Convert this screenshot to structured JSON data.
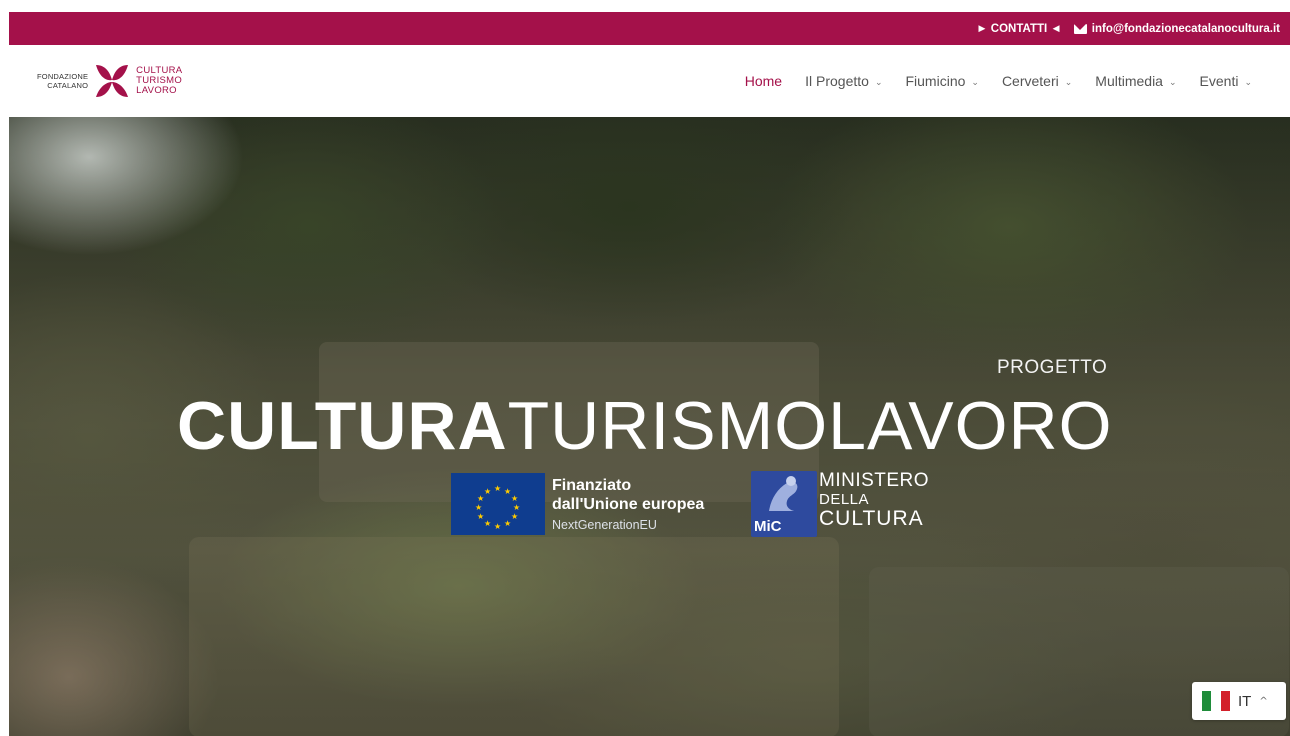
{
  "topbar": {
    "contact_label": "► CONTATTI ◄",
    "email": "info@fondazionecatalanocultura.it",
    "bg_color": "#a4114a"
  },
  "logo": {
    "left_line1": "FONDAZIONE",
    "left_line2": "CATALANO",
    "right_line1": "CULTURA",
    "right_line2": "TURISMO",
    "right_line3": "LAVORO",
    "brand_color": "#a4114a"
  },
  "nav": {
    "items": [
      {
        "label": "Home",
        "active": true,
        "has_dropdown": false
      },
      {
        "label": "Il Progetto",
        "active": false,
        "has_dropdown": true
      },
      {
        "label": "Fiumicino",
        "active": false,
        "has_dropdown": true
      },
      {
        "label": "Cerveteri",
        "active": false,
        "has_dropdown": true
      },
      {
        "label": "Multimedia",
        "active": false,
        "has_dropdown": true
      },
      {
        "label": "Eventi",
        "active": false,
        "has_dropdown": true
      }
    ],
    "chevron": "⌄"
  },
  "hero": {
    "kicker": "PROGETTO",
    "title_part1": "CULTURA",
    "title_part2": "TURISMO",
    "title_part3": "LAVORO"
  },
  "eu": {
    "line1": "Finanziato",
    "line2": "dall'Unione europea",
    "line3": "NextGenerationEU"
  },
  "mic": {
    "badge_label": "MiC",
    "line1": "MINISTERO",
    "line2": "DELLA",
    "line3": "CULTURA"
  },
  "lang": {
    "code": "IT",
    "caret": "^"
  }
}
